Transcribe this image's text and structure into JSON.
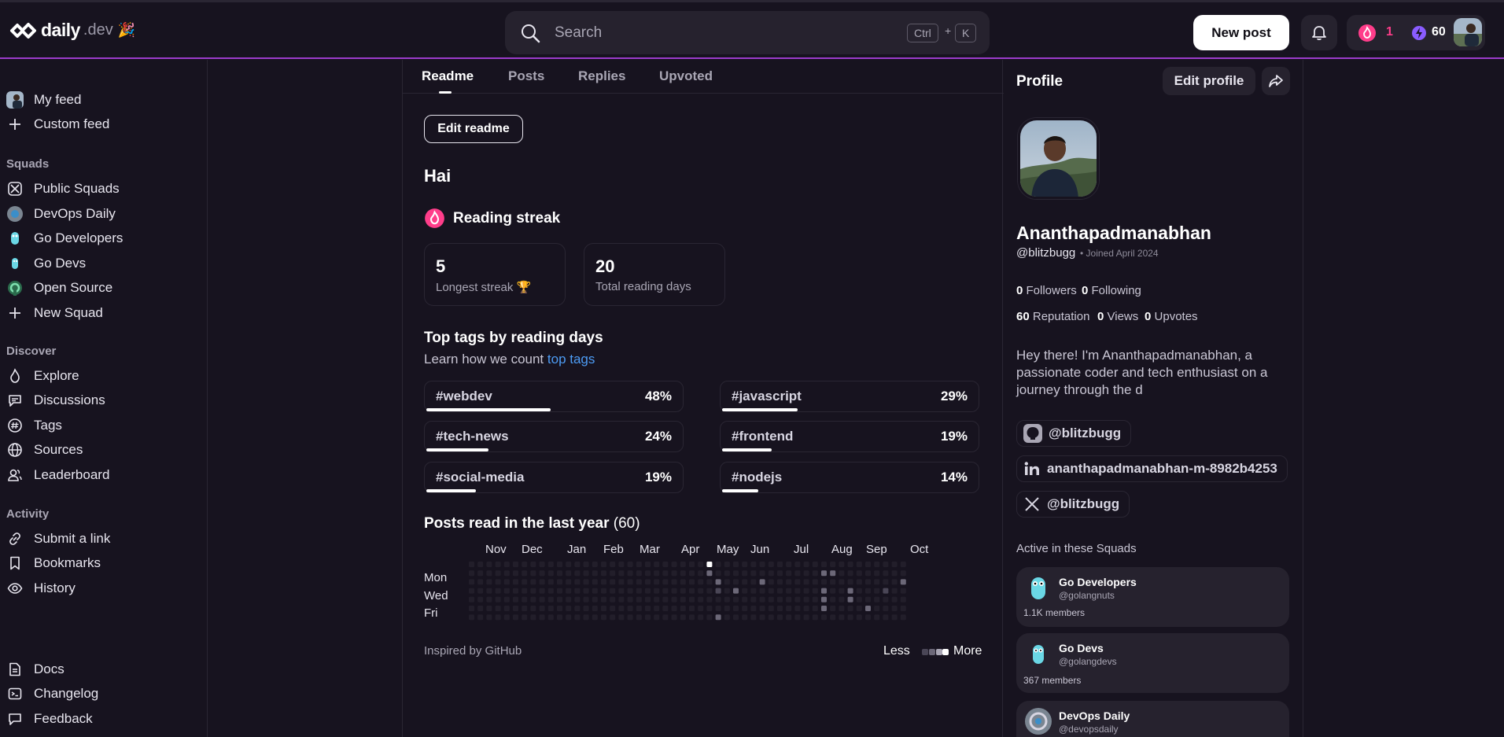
{
  "header": {
    "logo_text": "daily",
    "logo_suffix": ".dev",
    "search_placeholder": "Search",
    "kbd_ctrl": "Ctrl",
    "kbd_plus": "+",
    "kbd_k": "K",
    "new_post": "New post",
    "streak": "1",
    "reputation": "60"
  },
  "sidebar": {
    "feed_items": [
      "My feed",
      "Custom feed"
    ],
    "squads_head": "Squads",
    "squads": [
      "Public Squads",
      "DevOps Daily",
      "Go Developers",
      "Go Devs",
      "Open Source",
      "New Squad"
    ],
    "discover_head": "Discover",
    "discover": [
      "Explore",
      "Discussions",
      "Tags",
      "Sources",
      "Leaderboard"
    ],
    "activity_head": "Activity",
    "activity": [
      "Submit a link",
      "Bookmarks",
      "History"
    ],
    "bottom": [
      "Docs",
      "Changelog",
      "Feedback"
    ]
  },
  "main": {
    "tabs": [
      "Readme",
      "Posts",
      "Replies",
      "Upvoted"
    ],
    "edit_readme": "Edit readme",
    "readme_text": "Hai",
    "streak_title": "Reading streak",
    "longest_streak": "5",
    "longest_streak_label": "Longest streak 🏆",
    "total_days": "20",
    "total_days_label": "Total reading days",
    "tags_title": "Top tags by reading days",
    "tags_sub": "Learn how we count ",
    "tags_link": "top tags",
    "tags": [
      {
        "name": "#webdev",
        "pct": "48%",
        "value": 48
      },
      {
        "name": "#javascript",
        "pct": "29%",
        "value": 29
      },
      {
        "name": "#tech-news",
        "pct": "24%",
        "value": 24
      },
      {
        "name": "#frontend",
        "pct": "19%",
        "value": 19
      },
      {
        "name": "#social-media",
        "pct": "19%",
        "value": 19
      },
      {
        "name": "#nodejs",
        "pct": "14%",
        "value": 14
      }
    ],
    "posts_title": "Posts read in the last year",
    "posts_count": "(60)",
    "months": [
      "Nov",
      "Dec",
      "Jan",
      "Feb",
      "Mar",
      "Apr",
      "May",
      "Jun",
      "Jul",
      "Aug",
      "Sep",
      "Oct"
    ],
    "days": [
      "Mon",
      "Wed",
      "Fri"
    ],
    "inspired": "Inspired by GitHub",
    "less": "Less",
    "more": "More"
  },
  "profile": {
    "title": "Profile",
    "edit_profile": "Edit profile",
    "name": "Ananthapadmanabhan",
    "handle": "@blitzbugg",
    "joined": "• Joined April 2024",
    "followers_val": "0",
    "followers_lbl": "Followers",
    "following_val": "0",
    "following_lbl": "Following",
    "reputation_val": "60",
    "reputation_lbl": "Reputation",
    "views_val": "0",
    "views_lbl": "Views",
    "upvotes_val": "0",
    "upvotes_lbl": "Upvotes",
    "bio": "Hey there! I'm Ananthapadmanabhan, a passionate coder and tech enthusiast on a journey through the d",
    "github": "@blitzbugg",
    "linkedin": "ananthapadmanabhan-m-8982b4253",
    "twitter": "@blitzbugg",
    "squads_head": "Active in these Squads",
    "squads": [
      {
        "name": "Go Developers",
        "handle": "@golangnuts",
        "members": "1.1K members"
      },
      {
        "name": "Go Devs",
        "handle": "@golangdevs",
        "members": "367 members"
      },
      {
        "name": "DevOps Daily",
        "handle": "@devopsdaily",
        "members": ""
      }
    ]
  },
  "colors": {
    "background": "#17131f",
    "surface": "#26222e",
    "accent_purple": "#9b3ccb",
    "streak_pink": "#ff3d8a",
    "link_blue": "#4d9cf5",
    "reputation_purple": "#8a5cff"
  }
}
